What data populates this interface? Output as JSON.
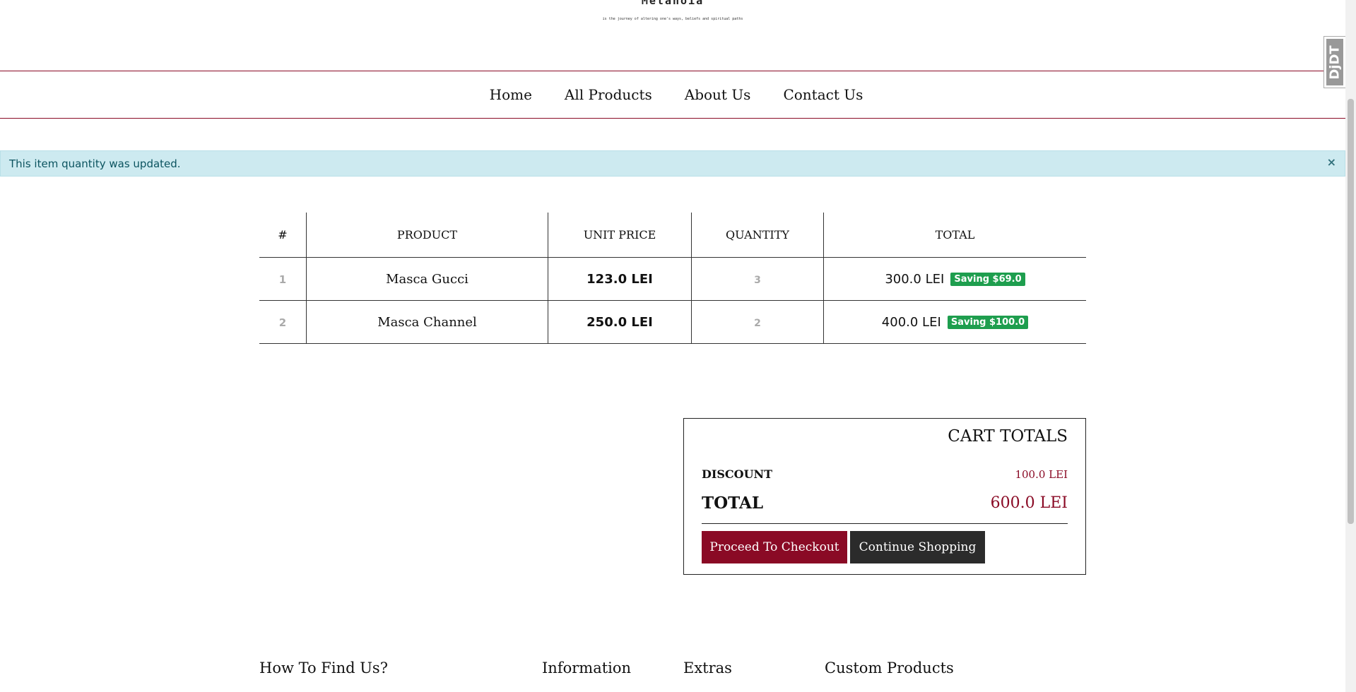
{
  "header": {
    "brand": "Metanoia",
    "tagline": "is the journey of altering one's ways, beliefs and spiritual paths"
  },
  "nav": {
    "items": [
      "Home",
      "All Products",
      "About Us",
      "Contact Us"
    ]
  },
  "alert": {
    "message": "This item quantity was updated.",
    "close_label": "×"
  },
  "cart": {
    "columns": [
      "#",
      "PRODUCT",
      "UNIT PRICE",
      "QUANTITY",
      "TOTAL"
    ],
    "rows": [
      {
        "index": "1",
        "product": "Masca Gucci",
        "unit_price": "123.0 LEI",
        "quantity": "3",
        "total": "300.0 LEI",
        "saving": "Saving $69.0"
      },
      {
        "index": "2",
        "product": "Masca Channel",
        "unit_price": "250.0 LEI",
        "quantity": "2",
        "total": "400.0 LEI",
        "saving": "Saving $100.0"
      }
    ]
  },
  "totals": {
    "title": "CART TOTALS",
    "discount_label": "DISCOUNT",
    "discount_value": "100.0 LEI",
    "total_label": "TOTAL",
    "total_value": "600.0 LEI",
    "checkout_label": "Proceed To Checkout",
    "continue_label": "Continue Shopping"
  },
  "footer": {
    "headings": [
      "How To Find Us?",
      "Information",
      "Extras",
      "Custom Products"
    ]
  },
  "debug_toolbar": {
    "label": "DjDT"
  },
  "colors": {
    "accent": "#8a0a25",
    "alert_bg": "#cdeaf0",
    "alert_text": "#0c5460",
    "badge": "#1e9e4e",
    "dark_button": "#2b2b2b"
  }
}
